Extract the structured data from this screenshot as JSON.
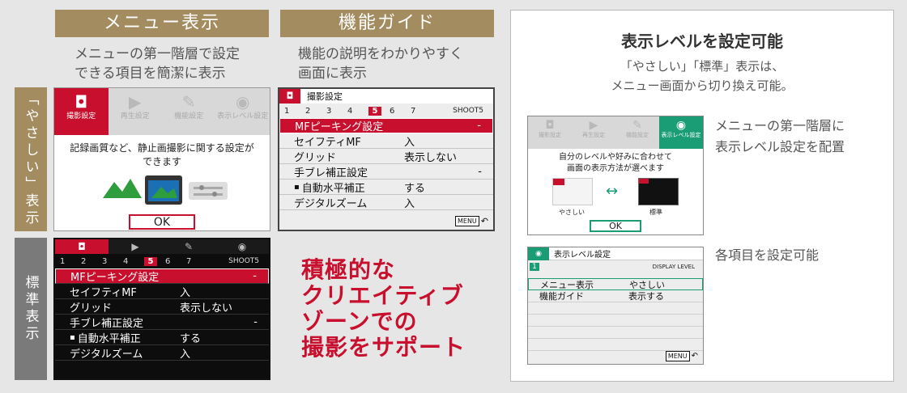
{
  "left": {
    "menu_header": "メニュー表示",
    "menu_desc": [
      "メニューの第一階層で設定",
      "できる項目を簡潔に表示"
    ],
    "guide_header": "機能ガイド",
    "guide_desc": [
      "機能の説明をわかりやすく",
      "画面に表示"
    ],
    "side_easy": "「やさしい」表示",
    "side_standard": "標準表示",
    "promo": [
      "積極的な",
      "クリエイティブ",
      "ゾーンでの",
      "撮影をサポート"
    ]
  },
  "easy_screen": {
    "tabs": [
      {
        "label": "撮影設定",
        "icon": "camera-icon",
        "glyph": "◘"
      },
      {
        "label": "再生設定",
        "icon": "play-icon",
        "glyph": "▶"
      },
      {
        "label": "機能設定",
        "icon": "wrench-icon",
        "glyph": "🔧"
      },
      {
        "label": "表示レベル設定",
        "icon": "display-level-icon",
        "glyph": "◉"
      }
    ],
    "message": [
      "記録画質など、静止画撮影に関する設定が",
      "できます"
    ],
    "ok": "OK"
  },
  "guide_screen": {
    "title": "撮影設定",
    "pages": [
      "1",
      "2",
      "3",
      "4",
      "5",
      "6",
      "7"
    ],
    "selected_page": "5",
    "shoot_label": "SHOOT5",
    "rows": [
      {
        "label": "MFピーキング設定",
        "value": "",
        "dash": "-"
      },
      {
        "label": "セイフティMF",
        "value": "入",
        "dash": ""
      },
      {
        "label": "グリッド",
        "value": "表示しない",
        "dash": ""
      },
      {
        "label": "手ブレ補正設定",
        "value": "",
        "dash": "-"
      },
      {
        "label": "自動水平補正",
        "value": "する",
        "dash": ""
      },
      {
        "label": "デジタルズーム",
        "value": "入",
        "dash": ""
      }
    ],
    "menu_btn": "MENU",
    "back_glyph": "⮌"
  },
  "standard_screen": {
    "pages": [
      "1",
      "2",
      "3",
      "4",
      "5",
      "6",
      "7"
    ],
    "selected_page": "5",
    "shoot_label": "SHOOT5",
    "rows": [
      {
        "label": "MFピーキング設定",
        "value": "",
        "dash": "-"
      },
      {
        "label": "セイフティMF",
        "value": "入",
        "dash": ""
      },
      {
        "label": "グリッド",
        "value": "表示しない",
        "dash": ""
      },
      {
        "label": "手ブレ補正設定",
        "value": "",
        "dash": "-"
      },
      {
        "label": "自動水平補正",
        "value": "する",
        "dash": ""
      },
      {
        "label": "デジタルズーム",
        "value": "入",
        "dash": ""
      }
    ]
  },
  "right": {
    "title": "表示レベルを設定可能",
    "sub": [
      "「やさしい」「標準」表示は、",
      "メニュー画面から切り換え可能。"
    ],
    "note1": [
      "メニューの第一階層に",
      "表示レベル設定を配置"
    ],
    "note2": "各項目を設定可能",
    "mini1": {
      "tabs": [
        "撮影設定",
        "再生設定",
        "機能設定",
        "表示レベル設定"
      ],
      "message": [
        "自分のレベルや好みに合わせて",
        "画面の表示方法が選べます"
      ],
      "easy_label": "やさしい",
      "std_label": "標準",
      "ok": "OK"
    },
    "mini2": {
      "title": "表示レベル設定",
      "page": "1",
      "caption": "DISPLAY LEVEL",
      "rows": [
        {
          "label": "メニュー表示",
          "value": "やさしい"
        },
        {
          "label": "機能ガイド",
          "value": "表示する"
        }
      ],
      "menu_btn": "MENU"
    }
  },
  "colors": {
    "accent": "#c8102e",
    "brand": "#a48c61",
    "level": "#1a9c74"
  }
}
